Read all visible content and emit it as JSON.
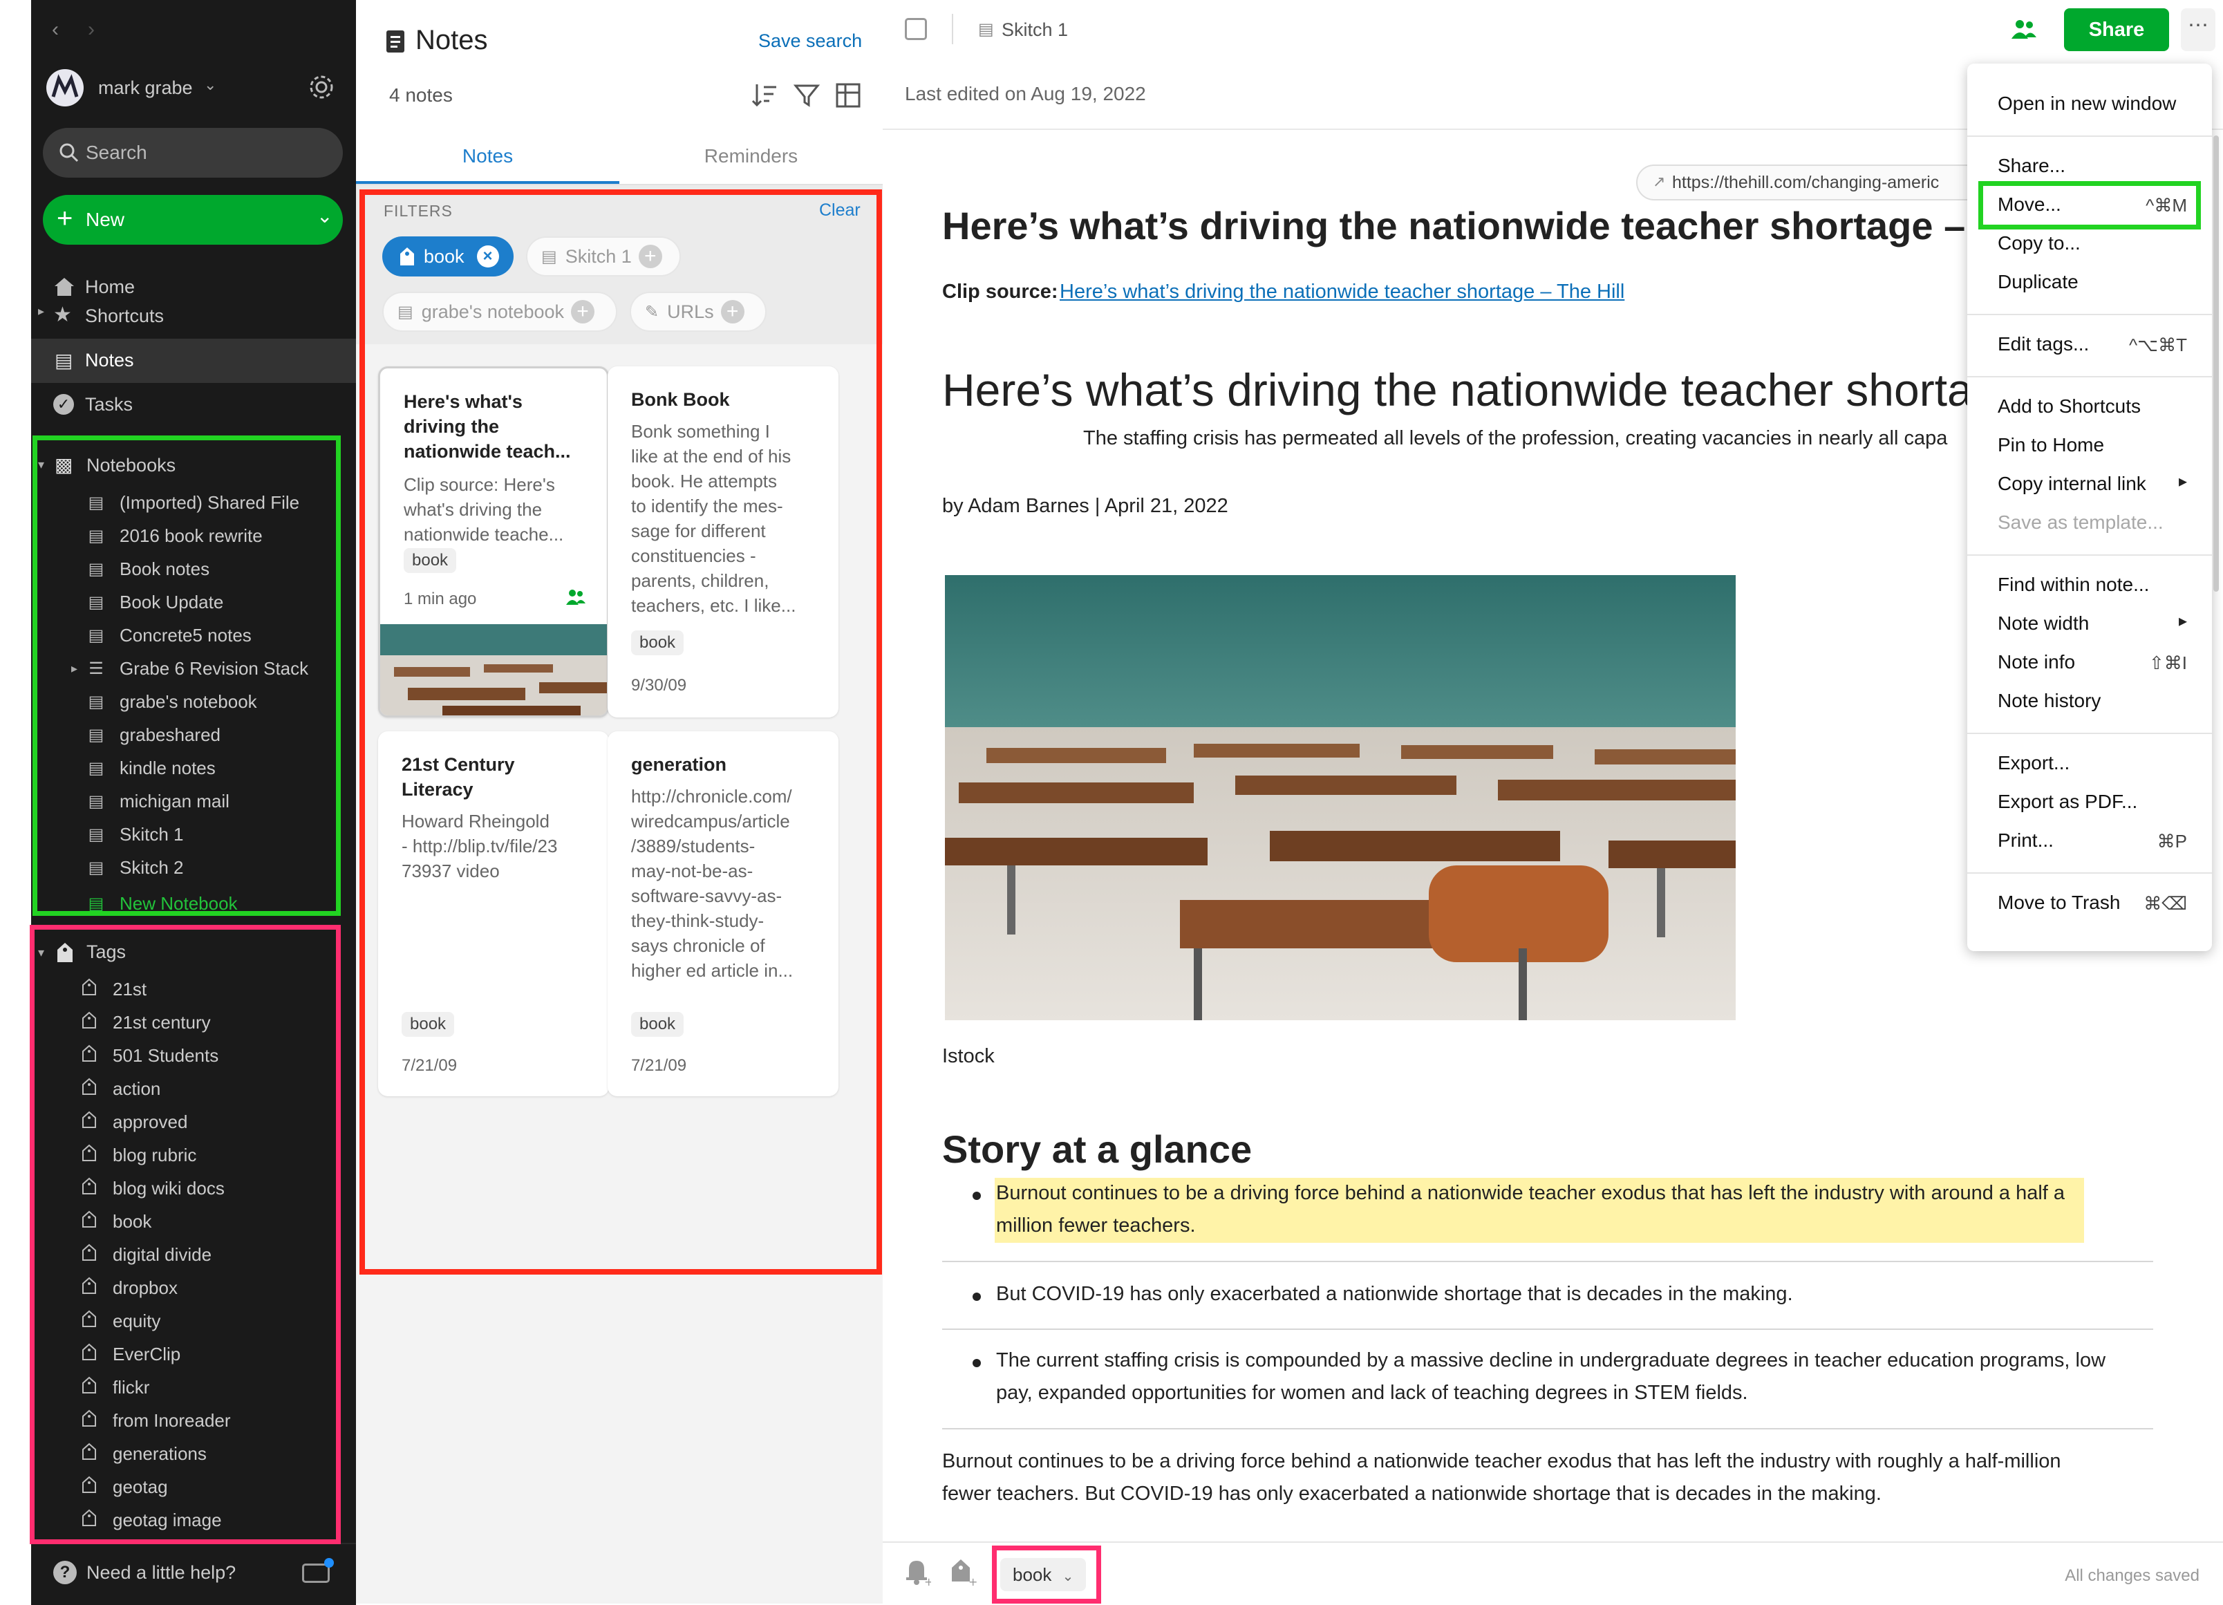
{
  "sidebar": {
    "account_name": "mark grabe",
    "search_label": "Search",
    "new_label": "New",
    "home": "Home",
    "shortcuts": "Shortcuts",
    "notes": "Notes",
    "tasks": "Tasks",
    "notebooks_header": "Notebooks",
    "notebooks": [
      "(Imported) Shared File",
      "2016 book rewrite",
      "Book notes",
      "Book Update",
      "Concrete5 notes",
      "Grabe 6 Revision Stack",
      "grabe's notebook",
      "grabeshared",
      "kindle notes",
      "michigan mail",
      "Skitch 1",
      "Skitch 2"
    ],
    "new_notebook": "New Notebook",
    "tags_header": "Tags",
    "tags": [
      "21st",
      "21st century",
      "501 Students",
      "action",
      "approved",
      "blog rubric",
      "blog wiki docs",
      "book",
      "digital divide",
      "dropbox",
      "equity",
      "EverClip",
      "flickr",
      "from Inoreader",
      "generations",
      "geotag",
      "geotag image"
    ],
    "help": "Need a little help?"
  },
  "notes_panel": {
    "title": "Notes",
    "save_search": "Save search",
    "count": "4 notes",
    "tab_notes": "Notes",
    "tab_reminders": "Reminders",
    "filters_label": "FILTERS",
    "clear_label": "Clear",
    "filter_chips": {
      "book": "book",
      "skitch": "Skitch 1",
      "notebook": "grabe's notebook",
      "urls": "URLs"
    },
    "cards": [
      {
        "title_1": "Here's what's",
        "title_2": "driving the",
        "title_3": "nationwide teach...",
        "snip_1": "Clip source: Here's",
        "snip_2": "what's driving the",
        "snip_3": "nationwide teache...",
        "tag": "book",
        "date": "1 min ago"
      },
      {
        "title_1": "Bonk Book",
        "snip_1": "Bonk something I",
        "snip_2": "like at the end of his",
        "snip_3": "book. He attempts",
        "snip_4": "to identify the mes-",
        "snip_5": "sage for different",
        "snip_6": "constituencies -",
        "snip_7": "parents, children,",
        "snip_8": "teachers, etc. I like...",
        "tag": "book",
        "date": "9/30/09"
      },
      {
        "title_1": "21st Century",
        "title_2": "Literacy",
        "snip_1": "Howard Rheingold",
        "snip_2": "- http://blip.tv/file/23",
        "snip_3": "73937 video",
        "tag": "book",
        "date": "7/21/09"
      },
      {
        "title_1": "generation",
        "snip_1": "http://chronicle.com/",
        "snip_2": "wiredcampus/article",
        "snip_3": "/3889/students-",
        "snip_4": "may-not-be-as-",
        "snip_5": "software-savvy-as-",
        "snip_6": "they-think-study-",
        "snip_7": "says chronicle of",
        "snip_8": "higher ed article in...",
        "tag": "book",
        "date": "7/21/09"
      }
    ]
  },
  "editor": {
    "breadcrumb": "Skitch 1",
    "share": "Share",
    "last_edited": "Last edited on Aug 19, 2022",
    "url": "https://thehill.com/changing-americ",
    "heading1": "Here’s what’s driving the nationwide teacher shortage – Th",
    "clip_label": "Clip source:",
    "clip_link": "Here’s what’s driving the nationwide teacher shortage – The Hill",
    "heading2": "Here’s what’s driving the nationwide teacher shorta",
    "subhead": "The staffing crisis has permeated all levels of the profession, creating vacancies in nearly all capa",
    "byline": "by Adam Barnes | April 21, 2022",
    "caption": "Istock",
    "story_heading": "Story at a glance",
    "bullet1_l1": "Burnout continues to be a driving force behind a nationwide teacher exodus that has left the industry with around a half a",
    "bullet1_l2": "million fewer teachers.",
    "bullet2": "But COVID-19 has only exacerbated a nationwide shortage that is decades in the making.",
    "bullet3_l1": "The current staffing crisis is compounded by a massive decline in undergraduate degrees in teacher education programs, low",
    "bullet3_l2": "pay, expanded opportunities for women and lack of teaching degrees in STEM fields.",
    "para_l1": "Burnout continues to be a driving force behind a nationwide teacher exodus that has left the industry with roughly a half-million",
    "para_l2": "fewer teachers. But COVID-19 has only exacerbated a nationwide shortage that is decades in the making.",
    "footer_tag": "book",
    "saved": "All changes saved"
  },
  "menu": {
    "open_new_window": "Open in new window",
    "share": "Share...",
    "move": "Move...",
    "move_sc": "^⌘M",
    "copy_to": "Copy to...",
    "duplicate": "Duplicate",
    "edit_tags": "Edit tags...",
    "edit_tags_sc": "^⌥⌘T",
    "add_shortcuts": "Add to Shortcuts",
    "pin_home": "Pin to Home",
    "copy_internal": "Copy internal link",
    "save_template": "Save as template...",
    "find_within": "Find within note...",
    "note_width": "Note width",
    "note_info": "Note info",
    "note_info_sc": "⇧⌘I",
    "note_history": "Note history",
    "export": "Export...",
    "export_pdf": "Export as PDF...",
    "print": "Print...",
    "print_sc": "⌘P",
    "trash": "Move to Trash",
    "trash_sc": "⌘⌫"
  },
  "colors": {
    "green": "#00a82d",
    "annotation_green": "#22d322",
    "annotation_pink": "#ff2d6f",
    "annotation_red": "#ff2a1a",
    "link": "#0b6fb8",
    "highlight": "#fff3a8"
  }
}
